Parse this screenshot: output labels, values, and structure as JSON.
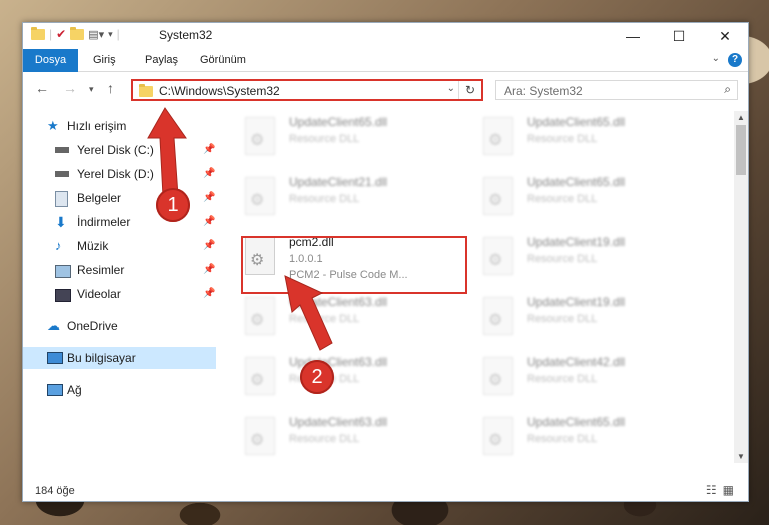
{
  "window": {
    "title": "System32"
  },
  "ribbon": {
    "tabs": [
      "Dosya",
      "Giriş",
      "Paylaş",
      "Görünüm"
    ]
  },
  "navigation": {
    "address": "C:\\Windows\\System32",
    "search_placeholder": "Ara: System32"
  },
  "sidebar": {
    "items": [
      {
        "label": "Hızlı erişim"
      },
      {
        "label": "Yerel Disk (C:)"
      },
      {
        "label": "Yerel Disk (D:)"
      },
      {
        "label": "Belgeler"
      },
      {
        "label": "İndirmeler"
      },
      {
        "label": "Müzik"
      },
      {
        "label": "Resimler"
      },
      {
        "label": "Videolar"
      },
      {
        "label": "OneDrive"
      },
      {
        "label": "Bu bilgisayar"
      },
      {
        "label": "Ağ"
      }
    ]
  },
  "files": {
    "left": [
      {
        "name": "UpdateClient65.dll",
        "sub": "Resource DLL"
      },
      {
        "name": "UpdateClient21.dll",
        "sub": "Resource DLL"
      },
      {
        "name": "pcm2.dll",
        "sub": "1.0.0.1",
        "desc": "PCM2 - Pulse Code M..."
      },
      {
        "name": "UpdateClient63.dll",
        "sub": "Resource DLL"
      },
      {
        "name": "UpdateClient63.dll",
        "sub": "Resource DLL"
      },
      {
        "name": "UpdateClient63.dll",
        "sub": "Resource DLL"
      }
    ],
    "right": [
      {
        "name": "UpdateClient65.dll",
        "sub": "Resource DLL"
      },
      {
        "name": "UpdateClient65.dll",
        "sub": "Resource DLL"
      },
      {
        "name": "UpdateClient19.dll",
        "sub": "Resource DLL"
      },
      {
        "name": "UpdateClient19.dll",
        "sub": "Resource DLL"
      },
      {
        "name": "UpdateClient42.dll",
        "sub": "Resource DLL"
      },
      {
        "name": "UpdateClient65.dll",
        "sub": "Resource DLL"
      }
    ]
  },
  "status": {
    "count": "184 öğe"
  },
  "annotations": {
    "one": "1",
    "two": "2"
  },
  "colors": {
    "accent": "#1979ca",
    "highlight": "#d9342b",
    "selection": "#cce8ff"
  }
}
